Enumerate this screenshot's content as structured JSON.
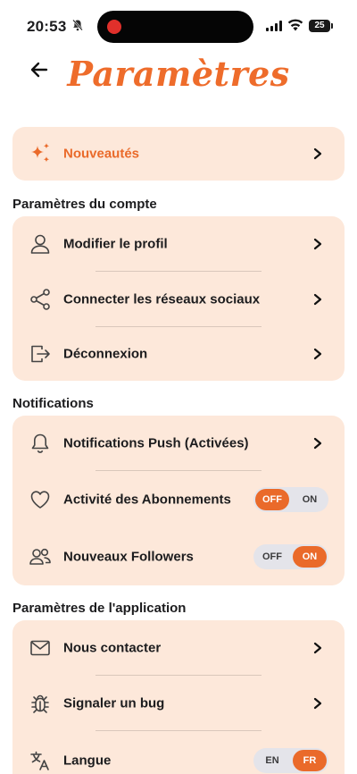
{
  "status_bar": {
    "time": "20:53",
    "battery": "25"
  },
  "header": {
    "title": "Paramètres"
  },
  "whats_new": {
    "label": "Nouveautés"
  },
  "account_section": {
    "title": "Paramètres du compte",
    "items": [
      {
        "label": "Modifier le profil",
        "icon": "user-icon"
      },
      {
        "label": "Connecter les réseaux sociaux",
        "icon": "share-icon"
      },
      {
        "label": "Déconnexion",
        "icon": "logout-icon"
      }
    ]
  },
  "notifications_section": {
    "title": "Notifications",
    "push": {
      "label": "Notifications Push (Activées)",
      "icon": "bell-icon"
    },
    "subscriptions_activity": {
      "label": "Activité des Abonnements",
      "icon": "heart-icon",
      "off_label": "OFF",
      "on_label": "ON",
      "selected": "OFF"
    },
    "new_followers": {
      "label": "Nouveaux Followers",
      "icon": "users-icon",
      "off_label": "OFF",
      "on_label": "ON",
      "selected": "ON"
    }
  },
  "app_section": {
    "title": "Paramètres de l'application",
    "contact": {
      "label": "Nous contacter",
      "icon": "mail-icon"
    },
    "report_bug": {
      "label": "Signaler un bug",
      "icon": "bug-icon"
    },
    "language": {
      "label": "Langue",
      "icon": "translate-icon",
      "en_label": "EN",
      "fr_label": "FR",
      "selected": "FR"
    }
  },
  "colors": {
    "accent": "#ea6a2a",
    "card_background": "#fde8da",
    "toggle_track": "#e4e4ea"
  }
}
